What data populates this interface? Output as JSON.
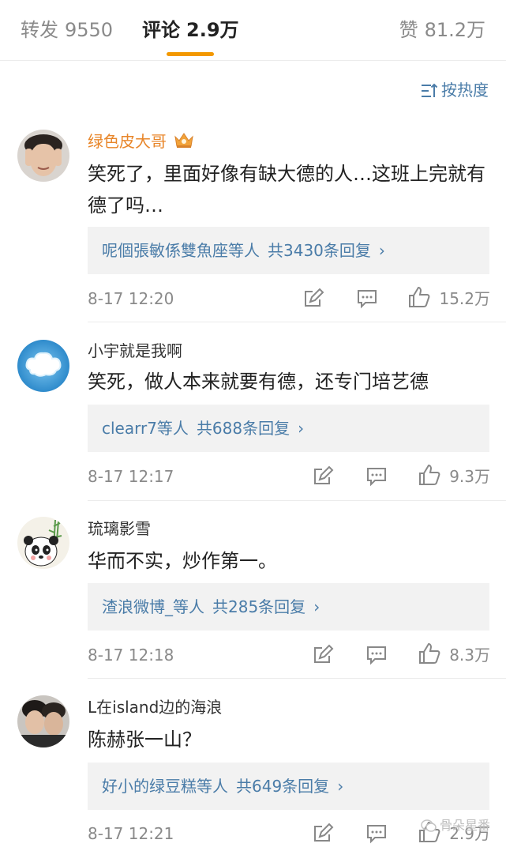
{
  "tabs": {
    "repost_label": "转发",
    "repost_count": "9550",
    "comment_label": "评论",
    "comment_count": "2.9万",
    "like_label": "赞",
    "like_count": "81.2万"
  },
  "sort_label": "按热度",
  "comments": [
    {
      "username": "绿色皮大哥",
      "text": "笑死了，里面好像有缺大德的人…这班上完就有德了吗…",
      "reply_users": "呢個張敏係雙魚座等人",
      "reply_count": "共3430条回复",
      "time": "8-17 12:20",
      "likes": "15.2万"
    },
    {
      "username": "小宇就是我啊",
      "text": "笑死，做人本来就要有德，还专门培艺德",
      "reply_users": "clearr7等人",
      "reply_count": "共688条回复",
      "time": "8-17 12:17",
      "likes": "9.3万"
    },
    {
      "username": "琉璃影雪",
      "text": "华而不实，炒作第一。",
      "reply_users": "渣浪微博_等人",
      "reply_count": "共285条回复",
      "time": "8-17 12:18",
      "likes": "8.3万"
    },
    {
      "username": "L在island边的海浪",
      "text": "陈赫张一山？",
      "reply_users": "好小的绿豆糕等人",
      "reply_count": "共649条回复",
      "time": "8-17 12:21",
      "likes": "2.9万"
    }
  ],
  "watermark": "骨朵星番",
  "colors": {
    "accent": "#f39800",
    "link": "#4a7ca8",
    "vip_name": "#e8862a",
    "muted": "#8a8a8a"
  },
  "icons": [
    "sort-icon",
    "crown-icon",
    "repost-icon",
    "reply-icon",
    "like-icon",
    "chevron-right-icon"
  ]
}
